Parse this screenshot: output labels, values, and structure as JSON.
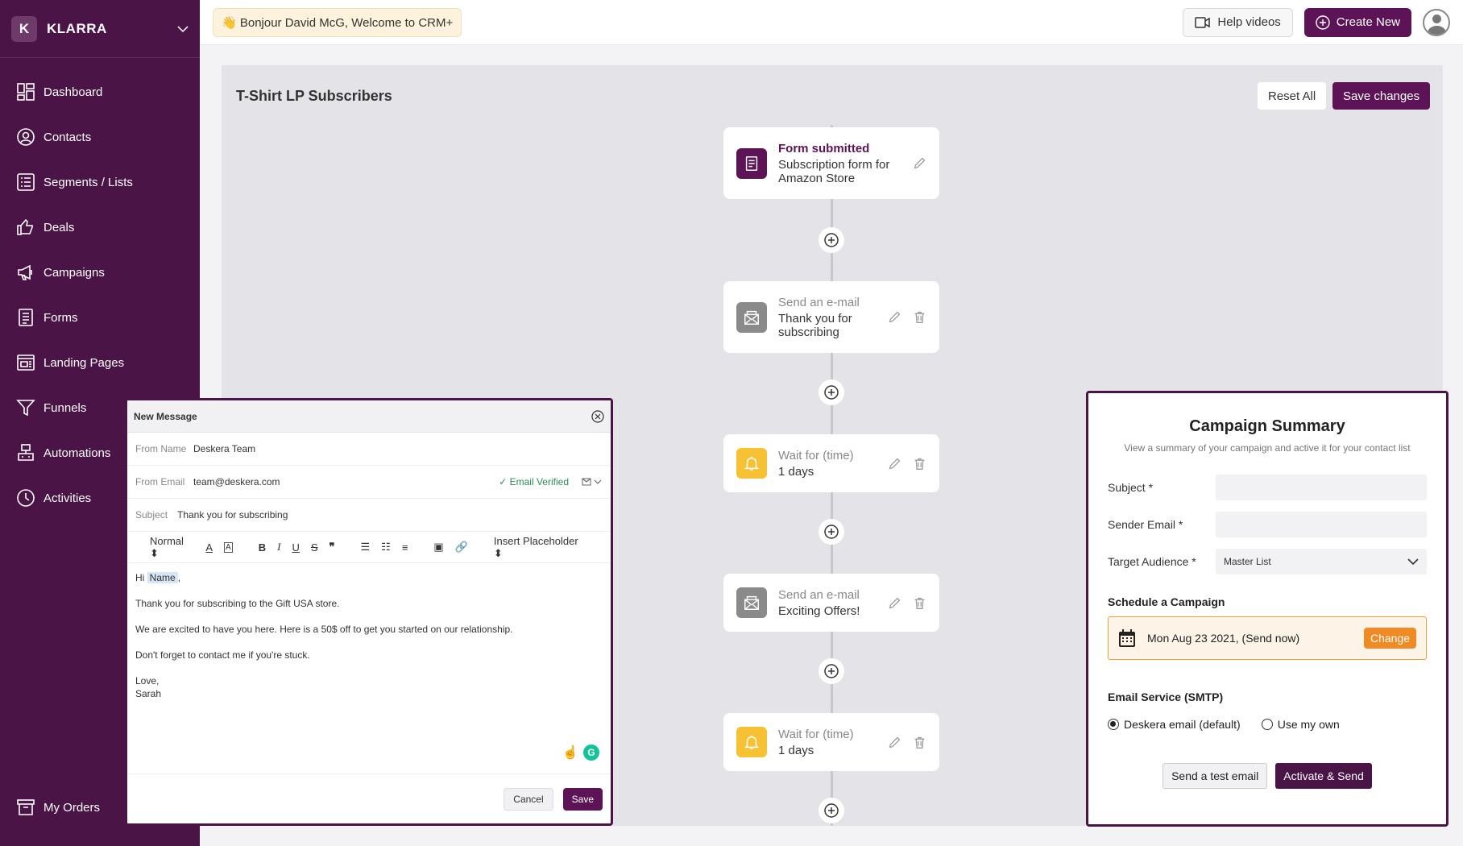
{
  "brand": {
    "initial": "K",
    "name": "KLARRA"
  },
  "sidebar": {
    "items": [
      {
        "label": "Dashboard",
        "icon": "dashboard-icon"
      },
      {
        "label": "Contacts",
        "icon": "contacts-icon"
      },
      {
        "label": "Segments / Lists",
        "icon": "list-icon"
      },
      {
        "label": "Deals",
        "icon": "thumbs-up-icon"
      },
      {
        "label": "Campaigns",
        "icon": "megaphone-icon"
      },
      {
        "label": "Forms",
        "icon": "form-icon"
      },
      {
        "label": "Landing Pages",
        "icon": "landing-page-icon"
      },
      {
        "label": "Funnels",
        "icon": "funnel-icon"
      },
      {
        "label": "Automations",
        "icon": "automation-icon"
      },
      {
        "label": "Activities",
        "icon": "clock-icon"
      }
    ],
    "bottom_item": {
      "label": "My Orders",
      "icon": "orders-icon"
    }
  },
  "topbar": {
    "welcome": "👋 Bonjour David McG, Welcome to CRM+",
    "help_videos": "Help videos",
    "create_new": "Create New"
  },
  "canvas": {
    "title": "T-Shirt LP Subscribers",
    "reset_all": "Reset All",
    "save_changes": "Save changes",
    "nodes": [
      {
        "title": "Form submitted",
        "subtitle": "Subscription form for Amazon Store",
        "icon": "form-icon"
      },
      {
        "title": "Send an e-mail",
        "subtitle": "Thank you for subscribing",
        "icon": "email-icon"
      },
      {
        "title": "Wait for (time)",
        "subtitle": "1 days",
        "icon": "bell-icon"
      },
      {
        "title": "Send an e-mail",
        "subtitle": "Exciting Offers!",
        "icon": "email-icon"
      },
      {
        "title": "Wait for (time)",
        "subtitle": "1 days",
        "icon": "bell-icon"
      }
    ]
  },
  "email_modal": {
    "title": "New Message",
    "from_name_label": "From Name",
    "from_name": "Deskera Team",
    "from_email_label": "From Email",
    "from_email": "team@deskera.com",
    "verified": "✓ Email Verified",
    "subject_label": "Subject",
    "subject": "Thank you for subscribing",
    "toolbar": {
      "format": "Normal ⬍",
      "placeholder": "Insert Placeholder ⬍"
    },
    "body": {
      "greeting_pre": "Hi ",
      "greeting_name": "Name",
      "greeting_post": ",",
      "line1": "Thank you for subscribing to the Gift USA store.",
      "line2": "We are excited to have you here. Here is a 50$ off to get you started on our relationship.",
      "line3": "Don't forget to contact me if you're stuck.",
      "signoff": "Love,",
      "signature": "Sarah"
    },
    "cancel": "Cancel",
    "save": "Save"
  },
  "summary": {
    "title": "Campaign Summary",
    "subtitle": "View a summary of your campaign and active it for your contact list",
    "subject_label": "Subject *",
    "sender_label": "Sender Email *",
    "audience_label": "Target Audience *",
    "audience_value": "Master List",
    "schedule_title": "Schedule a Campaign",
    "schedule_date": "Mon Aug 23 2021, (Send now)",
    "change": "Change",
    "smtp_title": "Email Service (SMTP)",
    "smtp_options": [
      {
        "label": "Deskera email (default)",
        "selected": true
      },
      {
        "label": "Use my own",
        "selected": false
      }
    ],
    "test_email": "Send a test email",
    "activate": "Activate & Send"
  }
}
